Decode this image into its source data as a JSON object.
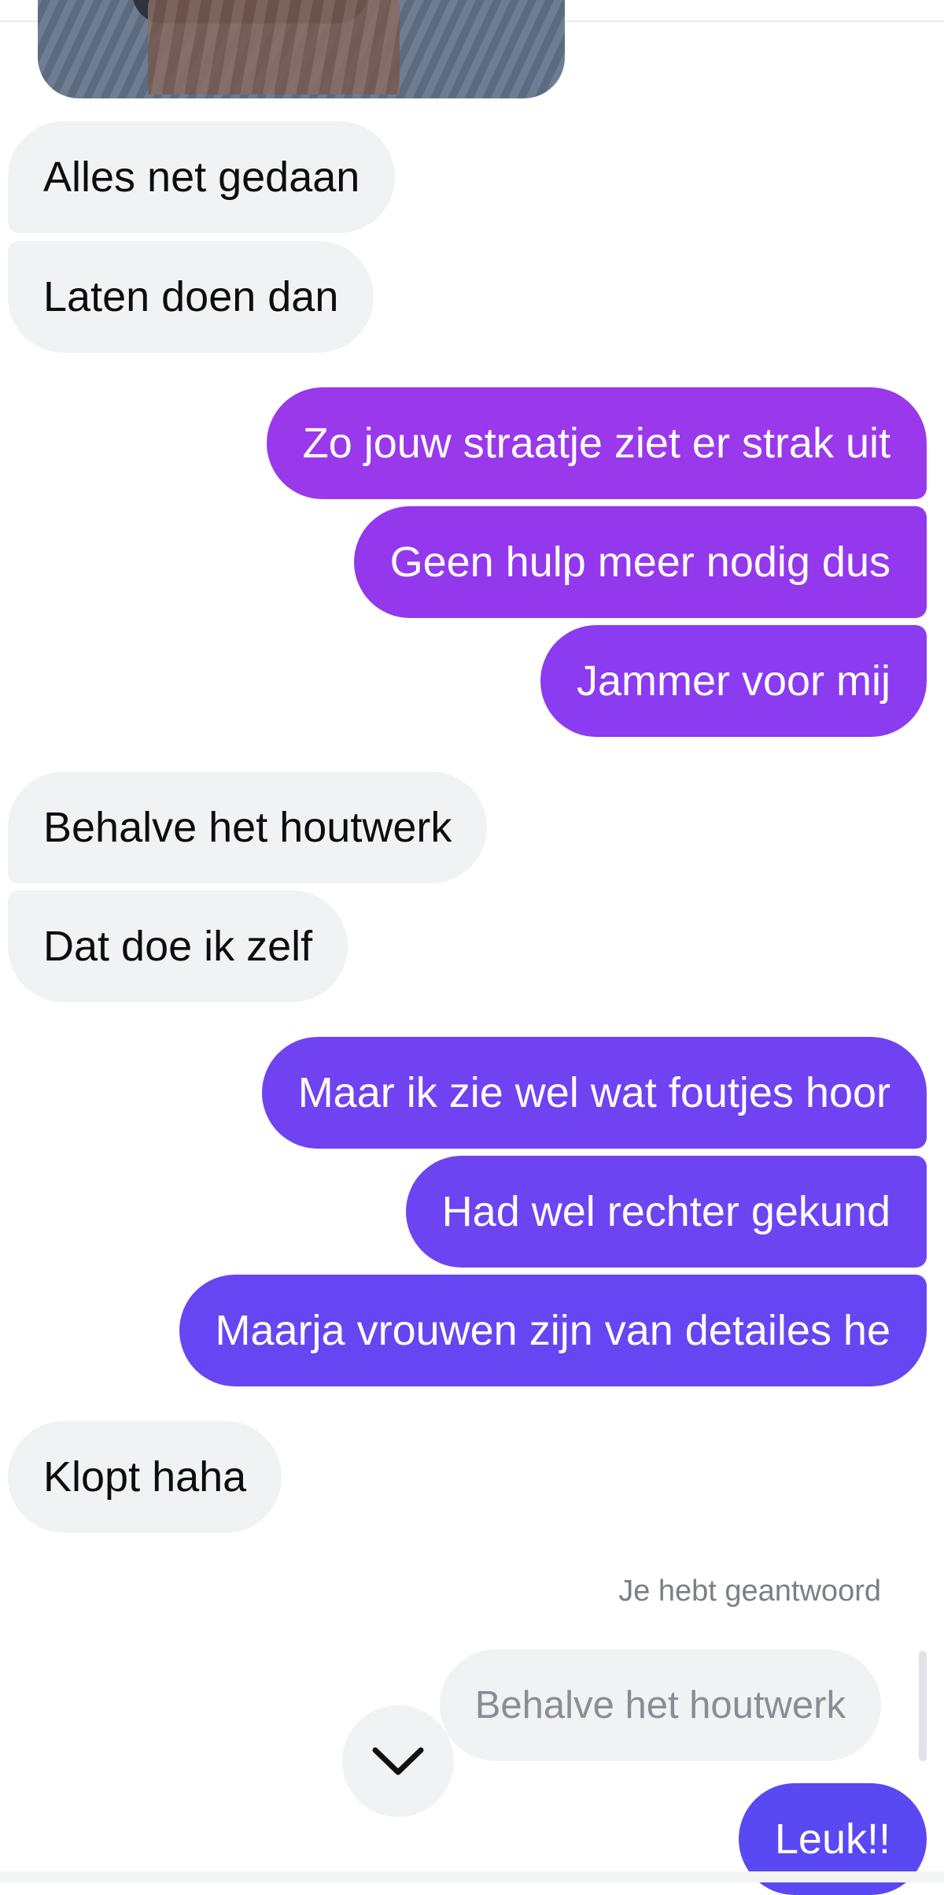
{
  "messages": [
    {
      "text": "Alles net gedaan"
    },
    {
      "text": "Laten doen dan"
    },
    {
      "text": "Zo jouw straatje ziet er strak uit"
    },
    {
      "text": "Geen hulp meer nodig dus"
    },
    {
      "text": "Jammer voor mij"
    },
    {
      "text": "Behalve het houtwerk"
    },
    {
      "text": "Dat doe ik zelf"
    },
    {
      "text": "Maar ik zie wel wat foutjes hoor"
    },
    {
      "text": "Had wel rechter gekund"
    },
    {
      "text": "Maarja vrouwen zijn van detailes he"
    },
    {
      "text": "Klopt haha"
    },
    {
      "text": "Leuk!!"
    }
  ],
  "reply": {
    "header": "Je hebt geantwoord",
    "quoted_text": "Behalve het houtwerk"
  },
  "icons": {
    "scroll_down": "chevron-down-icon"
  },
  "colors": {
    "incoming_bubble": "#f1f2f4",
    "outgoing_purple": "#8b3ff0",
    "outgoing_indigo": "#5a48f2"
  }
}
